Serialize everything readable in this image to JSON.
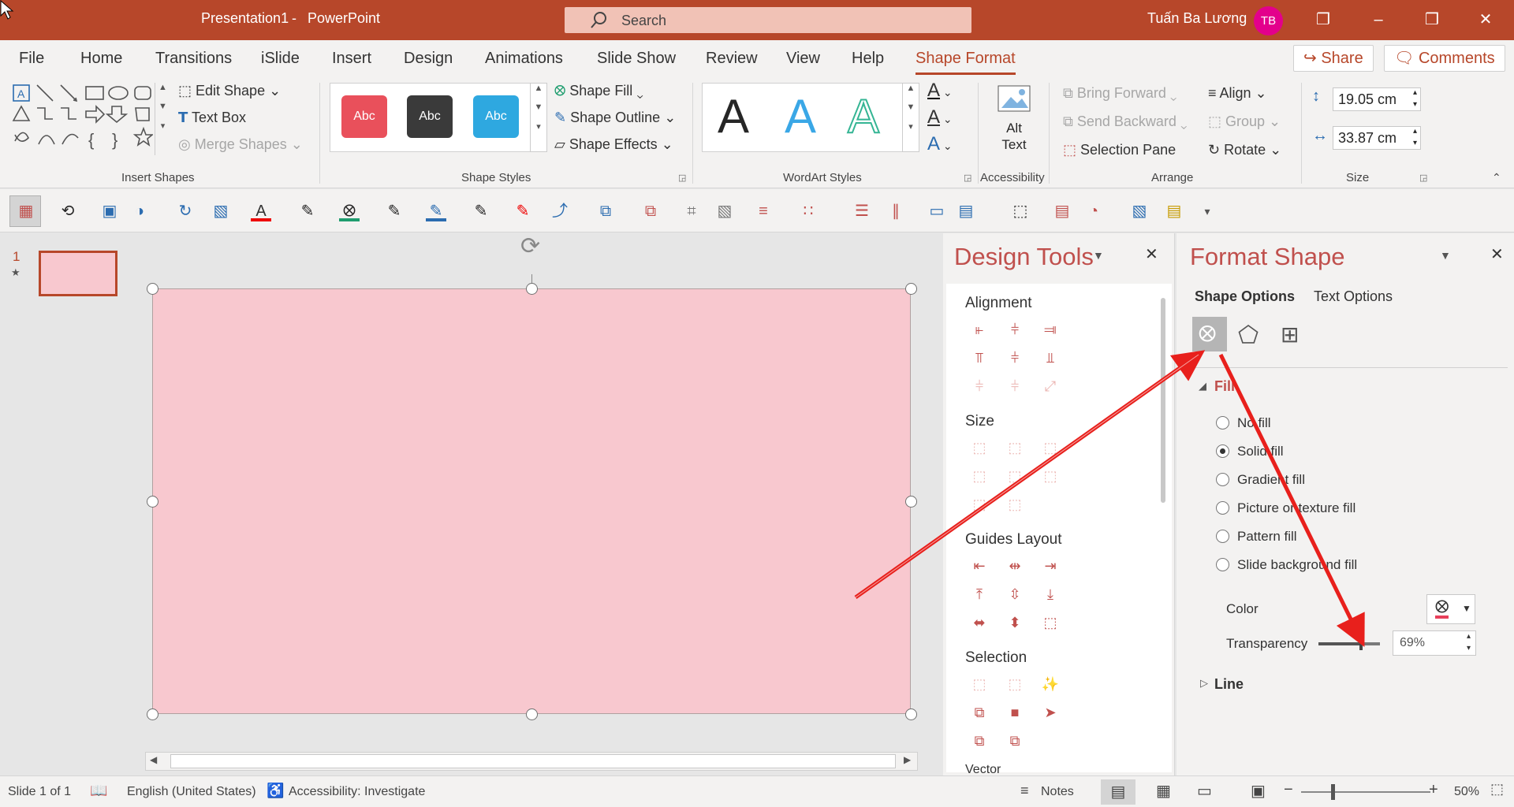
{
  "window": {
    "doc_title": "Presentation1",
    "app_name": "PowerPoint",
    "separator": "-",
    "user": "Tuấn Ba Lương",
    "user_initials": "TB"
  },
  "search": {
    "placeholder": "Search"
  },
  "tabs": [
    "File",
    "Home",
    "Transitions",
    "iSlide",
    "Insert",
    "Design",
    "Animations",
    "Slide Show",
    "Review",
    "View",
    "Help",
    "Shape Format"
  ],
  "header_buttons": {
    "share": "Share",
    "comments": "Comments"
  },
  "ribbon": {
    "insert_shapes": {
      "label": "Insert Shapes",
      "edit_shape": "Edit Shape",
      "text_box": "Text Box",
      "merge_shapes": "Merge Shapes"
    },
    "shape_styles": {
      "label": "Shape Styles",
      "swatches": [
        "Abc",
        "Abc",
        "Abc"
      ],
      "shape_fill": "Shape Fill",
      "shape_outline": "Shape Outline",
      "shape_effects": "Shape Effects"
    },
    "wordart": {
      "label": "WordArt Styles",
      "letters": [
        "A",
        "A",
        "A"
      ]
    },
    "accessibility": {
      "label": "Accessibility",
      "alt_text_1": "Alt",
      "alt_text_2": "Text"
    },
    "arrange": {
      "label": "Arrange",
      "bring_forward": "Bring Forward",
      "send_backward": "Send Backward",
      "selection_pane": "Selection Pane",
      "align": "Align",
      "group": "Group",
      "rotate": "Rotate"
    },
    "size": {
      "label": "Size",
      "height": "19.05 cm",
      "width": "33.87 cm"
    }
  },
  "thumbs": {
    "slide_number": "1",
    "star": "★"
  },
  "design_tools": {
    "title": "Design Tools",
    "sections": [
      "Alignment",
      "Size",
      "Guides Layout",
      "Selection",
      "Vector"
    ]
  },
  "format_shape": {
    "title": "Format Shape",
    "tabs": [
      "Shape Options",
      "Text Options"
    ],
    "fill_header": "Fill",
    "fill_options": [
      "No fill",
      "Solid fill",
      "Gradient fill",
      "Picture or texture fill",
      "Pattern fill",
      "Slide background fill"
    ],
    "selected_fill": "Solid fill",
    "color_label": "Color",
    "transparency_label": "Transparency",
    "transparency_value": "69%",
    "transparency_level": 0.69,
    "line_header": "Line"
  },
  "status": {
    "slide": "Slide 1 of 1",
    "language": "English (United States)",
    "accessibility": "Accessibility: Investigate",
    "notes": "Notes",
    "zoom": "50%"
  },
  "colors": {
    "accent": "#b7472a",
    "shape_fill": "#f8c8cf",
    "pane_title": "#c0504d",
    "arrow": "#e8201c"
  }
}
